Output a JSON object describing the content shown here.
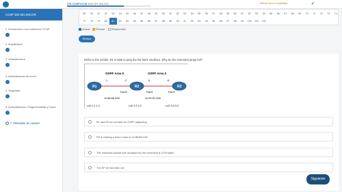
{
  "header": {
    "course_code": "ITN CCNP/CCIE",
    "course_suffix": "ENCOR 350-401",
    "progress": 0.68,
    "status_text": "Marcar como completado",
    "check": "✔"
  },
  "sidebar": {
    "title": "CCNP 350-401 ENCOR",
    "items": [
      {
        "label": "1. Introducción a los exámenes CCNP"
      },
      {
        "label": "2. Arquitectura"
      },
      {
        "label": "3. Infraestructura"
      },
      {
        "label": "4. Administración de la red"
      },
      {
        "label": "5. Seguridad"
      },
      {
        "label": "6. Automatización, Programmability y Cloud"
      },
      {
        "label": "7. Simulador de examen"
      }
    ]
  },
  "question_numbers": {
    "row1": [
      "36",
      "40",
      "41",
      "42",
      "43",
      "44",
      "45",
      "46",
      "47",
      "48",
      "49",
      "50",
      "51",
      "52",
      "53",
      "54",
      "55",
      "56",
      "57",
      "58",
      "59",
      "60",
      "61",
      "62",
      "63",
      "64",
      "65",
      "66",
      "67",
      "68",
      "69",
      "70",
      "71",
      "72",
      "73",
      "74",
      "75",
      "76"
    ],
    "row2": [
      "77",
      "78",
      "79",
      "80",
      "81",
      "82",
      "83",
      "84",
      "85",
      "86",
      "87",
      "88",
      "89",
      "90",
      "91",
      "92",
      "93",
      "94",
      "95",
      "96",
      "97",
      "98",
      "99",
      "100",
      "101",
      "102"
    ],
    "current": "81"
  },
  "legend": {
    "actual": "Actual",
    "review": "Revisar",
    "answered": "Respondido",
    "actual_color": "#2b73b6",
    "review_color": "#f0a030",
    "answered_color": "#ffffff"
  },
  "review_button": "Revisar Pregunta",
  "question": {
    "text": "Refer to the exhibit. R1 is able to ping the R3 fa0/1 interface. Why do the extended pings fail?",
    "diagram": {
      "area_left": "OSPF Area 0",
      "area_right": "OSPF Area 0",
      "r1": "R1",
      "r2": "R2",
      "r3": "R3",
      "fa_r2_left": "Fa0/0",
      "fa_r2_right": "Fa0/1",
      "fa_r3": "Fa0/1",
      "ip_left": "10.88.88.0/30",
      "ip_right": "10.99.99.4/30",
      "num_a": ".1",
      "num_b": ".2",
      "num_c": ".5",
      "num_d": ".6",
      "lo1": "Lo0 1.1.1.1",
      "lo2": "Lo0 2.2.2.2",
      "lo3": "Lo0 3.3.3.3"
    },
    "options": [
      "R1 and R3 do not have an OSPF adjacency",
      "R3 is missing a return route to 10.88.88.0/30",
      "The maximum packet size accepted by the command is 1476 bytes",
      "The DF bit has been set"
    ]
  },
  "next_button": "Siguiente"
}
